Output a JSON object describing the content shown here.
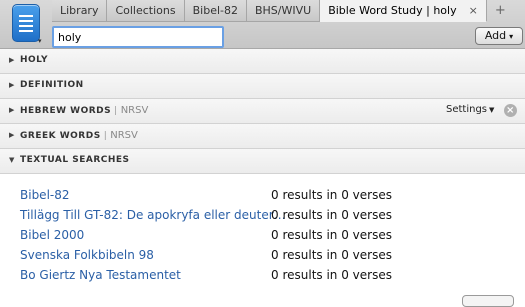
{
  "app": {
    "menu_icon": "library-menu-icon"
  },
  "tabs": [
    {
      "label": "Library"
    },
    {
      "label": "Collections"
    },
    {
      "label": "Bibel-82"
    },
    {
      "label": "BHS/WIVU"
    },
    {
      "label": "Bible Word Study | holy",
      "active": true
    }
  ],
  "tab_close": "×",
  "tab_new": "+",
  "search": {
    "value": "holy",
    "placeholder": ""
  },
  "add_button": {
    "label": "Add"
  },
  "sections": [
    {
      "label": "HOLY"
    },
    {
      "label": "DEFINITION"
    },
    {
      "label": "HEBREW WORDS",
      "source": "NRSV",
      "settings": "Settings"
    },
    {
      "label": "GREEK WORDS",
      "source": "NRSV"
    },
    {
      "label": "TEXTUAL SEARCHES",
      "expanded": true
    }
  ],
  "results": [
    {
      "name": "Bibel-82",
      "count": "0 results in 0 verses"
    },
    {
      "name": "Tillägg Till GT-82: De apokryfa eller deuter…",
      "count": "0 results in 0 verses"
    },
    {
      "name": "Bibel 2000",
      "count": "0 results in 0 verses"
    },
    {
      "name": "Svenska Folkbibeln 98",
      "count": "0 results in 0 verses"
    },
    {
      "name": "Bo Giertz Nya Testamentet",
      "count": "0 results in 0 verses"
    }
  ],
  "colors": {
    "link": "#2a5fa6",
    "search_focus": "#6aa0e4",
    "app_button": "#1f6fc8"
  }
}
